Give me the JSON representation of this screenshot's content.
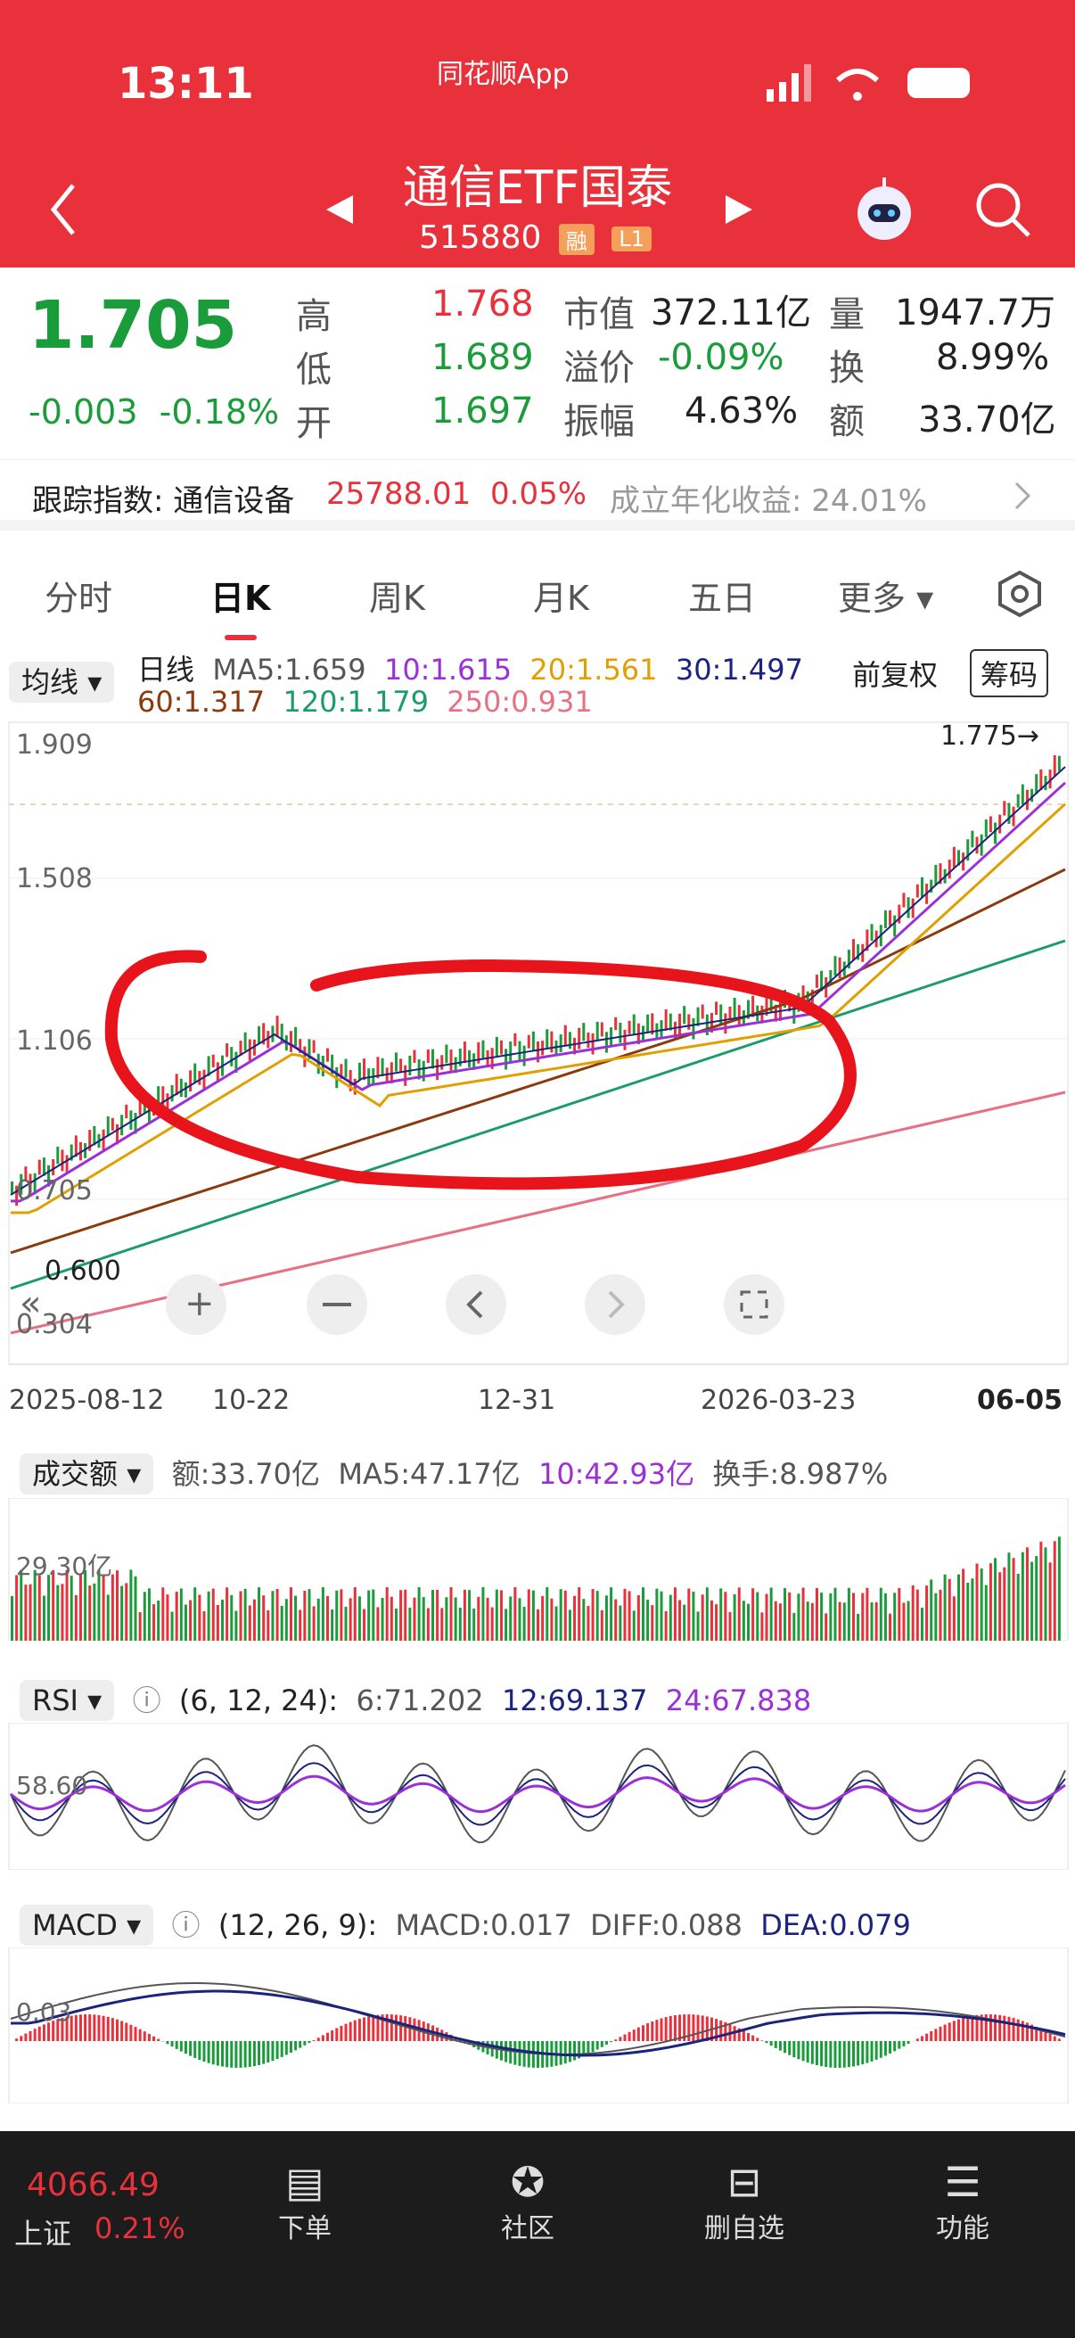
{
  "status": {
    "time": "13:11",
    "app": "同花顺App"
  },
  "header": {
    "title": "通信ETF国泰",
    "code": "515880",
    "badge1": "融",
    "badge2": "L1"
  },
  "quote": {
    "price": "1.705",
    "change": "-0.003",
    "pct": "-0.18%",
    "high_label": "高",
    "high": "1.768",
    "low_label": "低",
    "low": "1.689",
    "open_label": "开",
    "open": "1.697",
    "mv_label": "市值",
    "mv": "372.11亿",
    "prem_label": "溢价",
    "prem": "-0.09%",
    "amp_label": "振幅",
    "amp": "4.63%",
    "vol_label": "量",
    "vol": "1947.7万",
    "turn_label": "换",
    "turn": "8.99%",
    "amt_label": "额",
    "amt": "33.70亿"
  },
  "track": {
    "label": "跟踪指数: 通信设备",
    "value": "25788.01",
    "pct": "0.05%",
    "annual": "成立年化收益: 24.01%"
  },
  "tabs": [
    "分时",
    "日K",
    "周K",
    "月K",
    "五日",
    "更多"
  ],
  "ma": {
    "select": "均线",
    "line": "日线",
    "ma5": "MA5:1.659",
    "ma10": "10:1.615",
    "ma20": "20:1.561",
    "ma30": "30:1.497",
    "ma60": "60:1.317",
    "ma120": "120:1.179",
    "ma250": "250:0.931",
    "fq": "前复权",
    "chip": "筹码"
  },
  "chart": {
    "y_top": "1.909",
    "y2": "1.508",
    "y3": "1.106",
    "y4": "0.705",
    "y_low": "0.600",
    "y_bottom": "0.304",
    "high_mark": "1.775→",
    "dates": [
      "2025-08-12",
      "10-22",
      "12-31",
      "2026-03-23",
      "06-05"
    ]
  },
  "vol_panel": {
    "select": "成交额",
    "amt": "额:33.70亿",
    "ma5": "MA5:47.17亿",
    "ma10": "10:42.93亿",
    "turn": "换手:8.987%",
    "ylabel": "29.30亿"
  },
  "rsi_panel": {
    "select": "RSI",
    "params": "(6, 12, 24):",
    "r6": "6:71.202",
    "r12": "12:69.137",
    "r24": "24:67.838",
    "ylabel": "58.60"
  },
  "macd_panel": {
    "select": "MACD",
    "params": "(12, 26, 9):",
    "macd": "MACD:0.017",
    "diff": "DIFF:0.088",
    "dea": "DEA:0.079",
    "ylabel": "0.03"
  },
  "bottom": {
    "index_value": "4066.49",
    "index_name": "上证",
    "index_pct": "0.21%",
    "nav": [
      "下单",
      "社区",
      "删自选",
      "功能"
    ]
  },
  "colors": {
    "red": "#e8313b",
    "green": "#1a9c3a",
    "purple": "#9b30d9",
    "orange": "#e0a000",
    "navy": "#1a237e",
    "brown": "#8b3a0e",
    "teal": "#1a9c6a",
    "pink": "#e87085"
  }
}
